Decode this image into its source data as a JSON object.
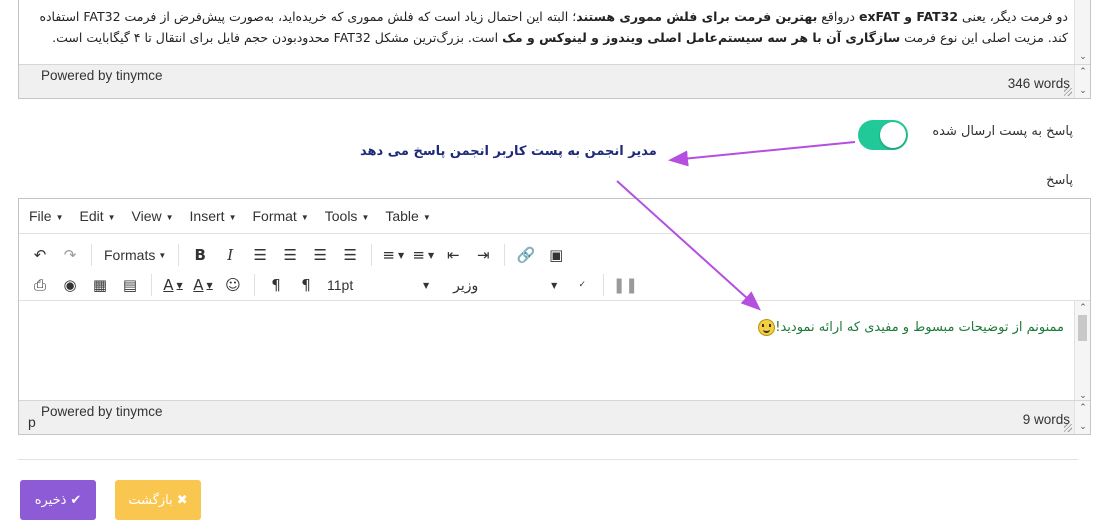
{
  "top_editor": {
    "paragraph_line1_parts": [
      "دو فرمت دیگر، یعنی ",
      "FAT32 و exFAT",
      " درواقع ",
      "بهترین فرمت برای فلش مموری هستند",
      "؛ البته این احتمال زیاد است که فلش مموری که خریده‌اید، به‌صورت پیش‌فرض از فرمت FAT32 استفاده"
    ],
    "paragraph_line2_parts": [
      "کند. مزیت اصلی این نوع فرمت ",
      "سازگاری آن با هر سه سیستم‌عامل اصلی ویندوز و لینوکس و مک",
      " است. بزرگ‌ترین مشکل FAT32 محدودبودن حجم فایل برای انتقال تا ۴ گیگابایت است."
    ],
    "powered_by": "Powered by tinymce",
    "word_count": "346 words"
  },
  "toggle": {
    "label": "پاسخ به پست ارسال شده",
    "checked": true,
    "color": "#20c997"
  },
  "annotation": "مدیر انجمن به پست کاربر انجمن پاسخ می دهد",
  "annotation_arrow_color": "#b44fe0",
  "reply_label": "پاسخ",
  "editor": {
    "menus": [
      "File",
      "Edit",
      "View",
      "Insert",
      "Format",
      "Tools",
      "Table"
    ],
    "formats_label": "Formats",
    "font_size": "11pt",
    "font_family": "وزیر",
    "content": "ممنونم از توضیحات مبسوط و مفیدی که ارائه نمودید!",
    "content_color": "#1d7a3a",
    "powered_by": "Powered by tinymce",
    "path": "p",
    "word_count": "9 words",
    "toolbar_icons": [
      "undo-icon",
      "redo-icon",
      "bold-icon",
      "italic-icon",
      "align-left-icon",
      "align-center-icon",
      "align-right-icon",
      "justify-icon",
      "bullet-list-icon",
      "numbered-list-icon",
      "outdent-icon",
      "indent-icon",
      "link-icon",
      "image-icon",
      "print-icon",
      "preview-icon",
      "media-icon",
      "map-icon",
      "text-color-icon",
      "background-color-icon",
      "emoticon-icon",
      "ltr-icon",
      "rtl-icon",
      "spellcheck-icon",
      "pagebreak-icon"
    ]
  },
  "buttons": {
    "save": "ذخیره",
    "back": "بازگشت",
    "save_color": "#8e5bd6",
    "back_color": "#f9c74f"
  }
}
